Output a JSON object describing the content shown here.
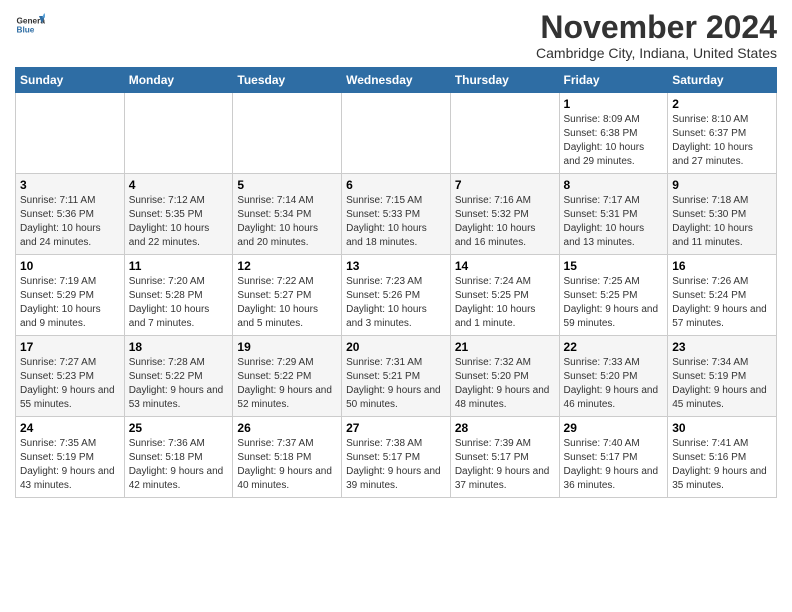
{
  "logo": {
    "general": "General",
    "blue": "Blue"
  },
  "title": "November 2024",
  "subtitle": "Cambridge City, Indiana, United States",
  "days_of_week": [
    "Sunday",
    "Monday",
    "Tuesday",
    "Wednesday",
    "Thursday",
    "Friday",
    "Saturday"
  ],
  "weeks": [
    [
      {
        "day": "",
        "info": ""
      },
      {
        "day": "",
        "info": ""
      },
      {
        "day": "",
        "info": ""
      },
      {
        "day": "",
        "info": ""
      },
      {
        "day": "",
        "info": ""
      },
      {
        "day": "1",
        "info": "Sunrise: 8:09 AM\nSunset: 6:38 PM\nDaylight: 10 hours and 29 minutes."
      },
      {
        "day": "2",
        "info": "Sunrise: 8:10 AM\nSunset: 6:37 PM\nDaylight: 10 hours and 27 minutes."
      }
    ],
    [
      {
        "day": "3",
        "info": "Sunrise: 7:11 AM\nSunset: 5:36 PM\nDaylight: 10 hours and 24 minutes."
      },
      {
        "day": "4",
        "info": "Sunrise: 7:12 AM\nSunset: 5:35 PM\nDaylight: 10 hours and 22 minutes."
      },
      {
        "day": "5",
        "info": "Sunrise: 7:14 AM\nSunset: 5:34 PM\nDaylight: 10 hours and 20 minutes."
      },
      {
        "day": "6",
        "info": "Sunrise: 7:15 AM\nSunset: 5:33 PM\nDaylight: 10 hours and 18 minutes."
      },
      {
        "day": "7",
        "info": "Sunrise: 7:16 AM\nSunset: 5:32 PM\nDaylight: 10 hours and 16 minutes."
      },
      {
        "day": "8",
        "info": "Sunrise: 7:17 AM\nSunset: 5:31 PM\nDaylight: 10 hours and 13 minutes."
      },
      {
        "day": "9",
        "info": "Sunrise: 7:18 AM\nSunset: 5:30 PM\nDaylight: 10 hours and 11 minutes."
      }
    ],
    [
      {
        "day": "10",
        "info": "Sunrise: 7:19 AM\nSunset: 5:29 PM\nDaylight: 10 hours and 9 minutes."
      },
      {
        "day": "11",
        "info": "Sunrise: 7:20 AM\nSunset: 5:28 PM\nDaylight: 10 hours and 7 minutes."
      },
      {
        "day": "12",
        "info": "Sunrise: 7:22 AM\nSunset: 5:27 PM\nDaylight: 10 hours and 5 minutes."
      },
      {
        "day": "13",
        "info": "Sunrise: 7:23 AM\nSunset: 5:26 PM\nDaylight: 10 hours and 3 minutes."
      },
      {
        "day": "14",
        "info": "Sunrise: 7:24 AM\nSunset: 5:25 PM\nDaylight: 10 hours and 1 minute."
      },
      {
        "day": "15",
        "info": "Sunrise: 7:25 AM\nSunset: 5:25 PM\nDaylight: 9 hours and 59 minutes."
      },
      {
        "day": "16",
        "info": "Sunrise: 7:26 AM\nSunset: 5:24 PM\nDaylight: 9 hours and 57 minutes."
      }
    ],
    [
      {
        "day": "17",
        "info": "Sunrise: 7:27 AM\nSunset: 5:23 PM\nDaylight: 9 hours and 55 minutes."
      },
      {
        "day": "18",
        "info": "Sunrise: 7:28 AM\nSunset: 5:22 PM\nDaylight: 9 hours and 53 minutes."
      },
      {
        "day": "19",
        "info": "Sunrise: 7:29 AM\nSunset: 5:22 PM\nDaylight: 9 hours and 52 minutes."
      },
      {
        "day": "20",
        "info": "Sunrise: 7:31 AM\nSunset: 5:21 PM\nDaylight: 9 hours and 50 minutes."
      },
      {
        "day": "21",
        "info": "Sunrise: 7:32 AM\nSunset: 5:20 PM\nDaylight: 9 hours and 48 minutes."
      },
      {
        "day": "22",
        "info": "Sunrise: 7:33 AM\nSunset: 5:20 PM\nDaylight: 9 hours and 46 minutes."
      },
      {
        "day": "23",
        "info": "Sunrise: 7:34 AM\nSunset: 5:19 PM\nDaylight: 9 hours and 45 minutes."
      }
    ],
    [
      {
        "day": "24",
        "info": "Sunrise: 7:35 AM\nSunset: 5:19 PM\nDaylight: 9 hours and 43 minutes."
      },
      {
        "day": "25",
        "info": "Sunrise: 7:36 AM\nSunset: 5:18 PM\nDaylight: 9 hours and 42 minutes."
      },
      {
        "day": "26",
        "info": "Sunrise: 7:37 AM\nSunset: 5:18 PM\nDaylight: 9 hours and 40 minutes."
      },
      {
        "day": "27",
        "info": "Sunrise: 7:38 AM\nSunset: 5:17 PM\nDaylight: 9 hours and 39 minutes."
      },
      {
        "day": "28",
        "info": "Sunrise: 7:39 AM\nSunset: 5:17 PM\nDaylight: 9 hours and 37 minutes."
      },
      {
        "day": "29",
        "info": "Sunrise: 7:40 AM\nSunset: 5:17 PM\nDaylight: 9 hours and 36 minutes."
      },
      {
        "day": "30",
        "info": "Sunrise: 7:41 AM\nSunset: 5:16 PM\nDaylight: 9 hours and 35 minutes."
      }
    ]
  ]
}
